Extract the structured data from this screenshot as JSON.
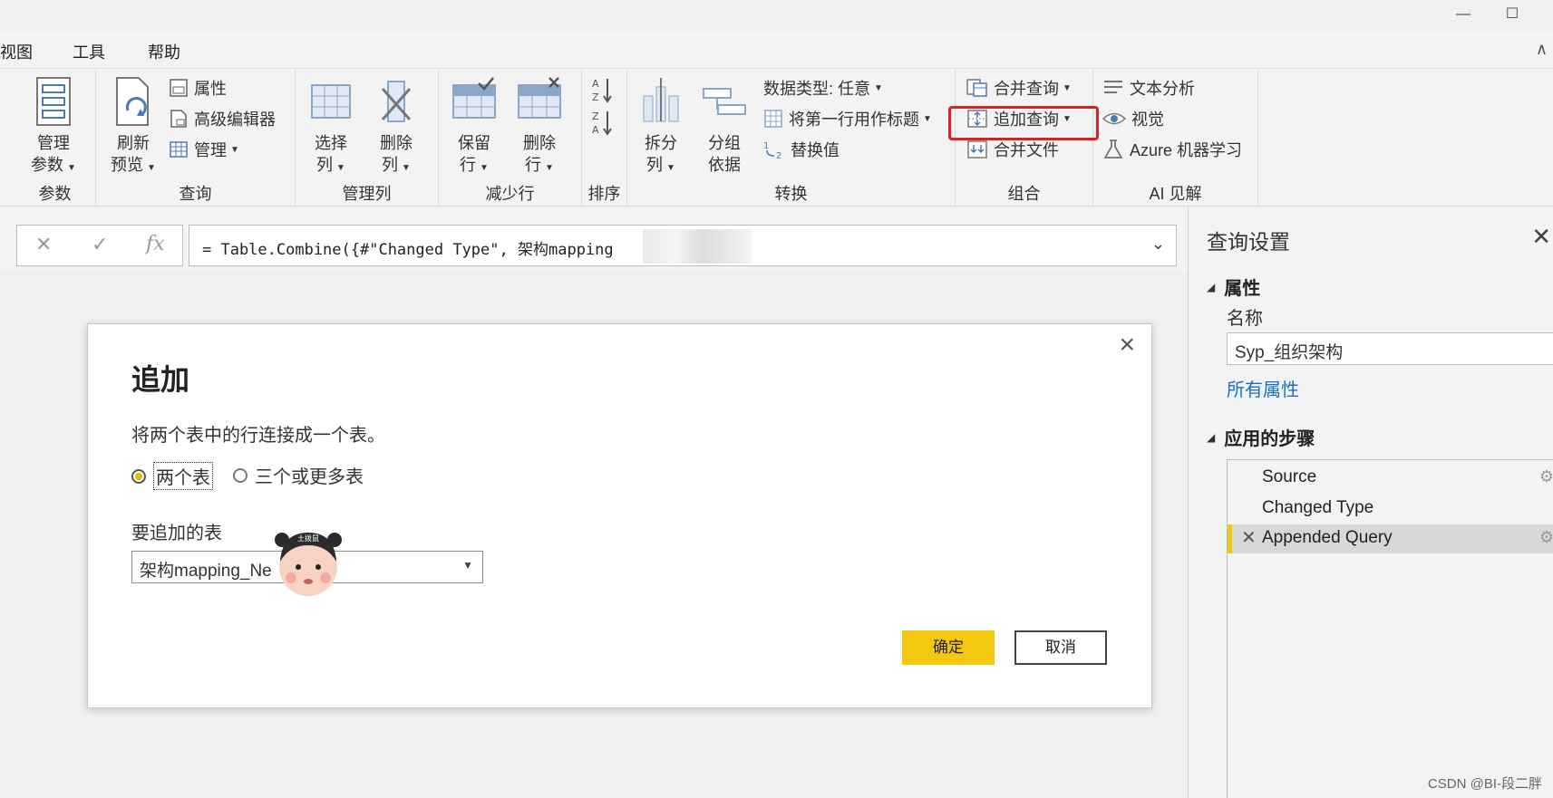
{
  "window": {
    "minimize_glyph": "—",
    "maximize_glyph": "☐"
  },
  "menu": {
    "items": [
      "视图",
      "工具",
      "帮助"
    ],
    "collapse_glyph": "∧"
  },
  "ribbon": {
    "groups": {
      "params": {
        "label": "参数",
        "manage_params": "管理",
        "manage_params_2": "参数"
      },
      "query": {
        "label": "查询",
        "refresh": "刷新",
        "refresh_2": "预览",
        "properties": "属性",
        "advanced_editor": "高级编辑器",
        "manage": "管理"
      },
      "manage_cols": {
        "label": "管理列",
        "choose": "选择",
        "choose_2": "列",
        "remove": "删除",
        "remove_2": "列"
      },
      "reduce_rows": {
        "label": "减少行",
        "keep": "保留",
        "keep_2": "行",
        "remove": "删除",
        "remove_2": "行"
      },
      "sort": {
        "label": "排序"
      },
      "transform": {
        "label": "转换",
        "split": "拆分",
        "split_2": "列",
        "group": "分组",
        "group_2": "依据",
        "data_type": "数据类型: 任意",
        "first_row": "将第一行用作标题",
        "replace": "替换值"
      },
      "combine": {
        "label": "组合",
        "merge": "合并查询",
        "append": "追加查询",
        "merge_files": "合并文件"
      },
      "ai": {
        "label": "AI 见解",
        "text_analysis": "文本分析",
        "vision": "视觉",
        "azure_ml": "Azure 机器学习"
      }
    }
  },
  "formula": {
    "text": "= Table.Combine({#\"Changed Type\", 架构mapping",
    "fx": "fx",
    "cancel_glyph": "✕",
    "confirm_glyph": "✓"
  },
  "dialog": {
    "title": "追加",
    "description": "将两个表中的行连接成一个表。",
    "option_two": "两个表",
    "option_many": "三个或更多表",
    "field_label": "要追加的表",
    "select_value": "架构mapping_Ne",
    "sticker_text": "土拨鼠",
    "ok": "确定",
    "cancel": "取消"
  },
  "query_settings": {
    "title": "查询设置",
    "properties_heading": "属性",
    "name_label": "名称",
    "name_value": "Syp_组织架构",
    "all_properties": "所有属性",
    "steps_heading": "应用的步骤",
    "steps": [
      "Source",
      "Changed Type",
      "Appended Query"
    ]
  },
  "watermark": "CSDN @BI-段二胖",
  "colors": {
    "accent": "#f2c811",
    "highlight": "#e02020",
    "link": "#1a6fc4"
  }
}
